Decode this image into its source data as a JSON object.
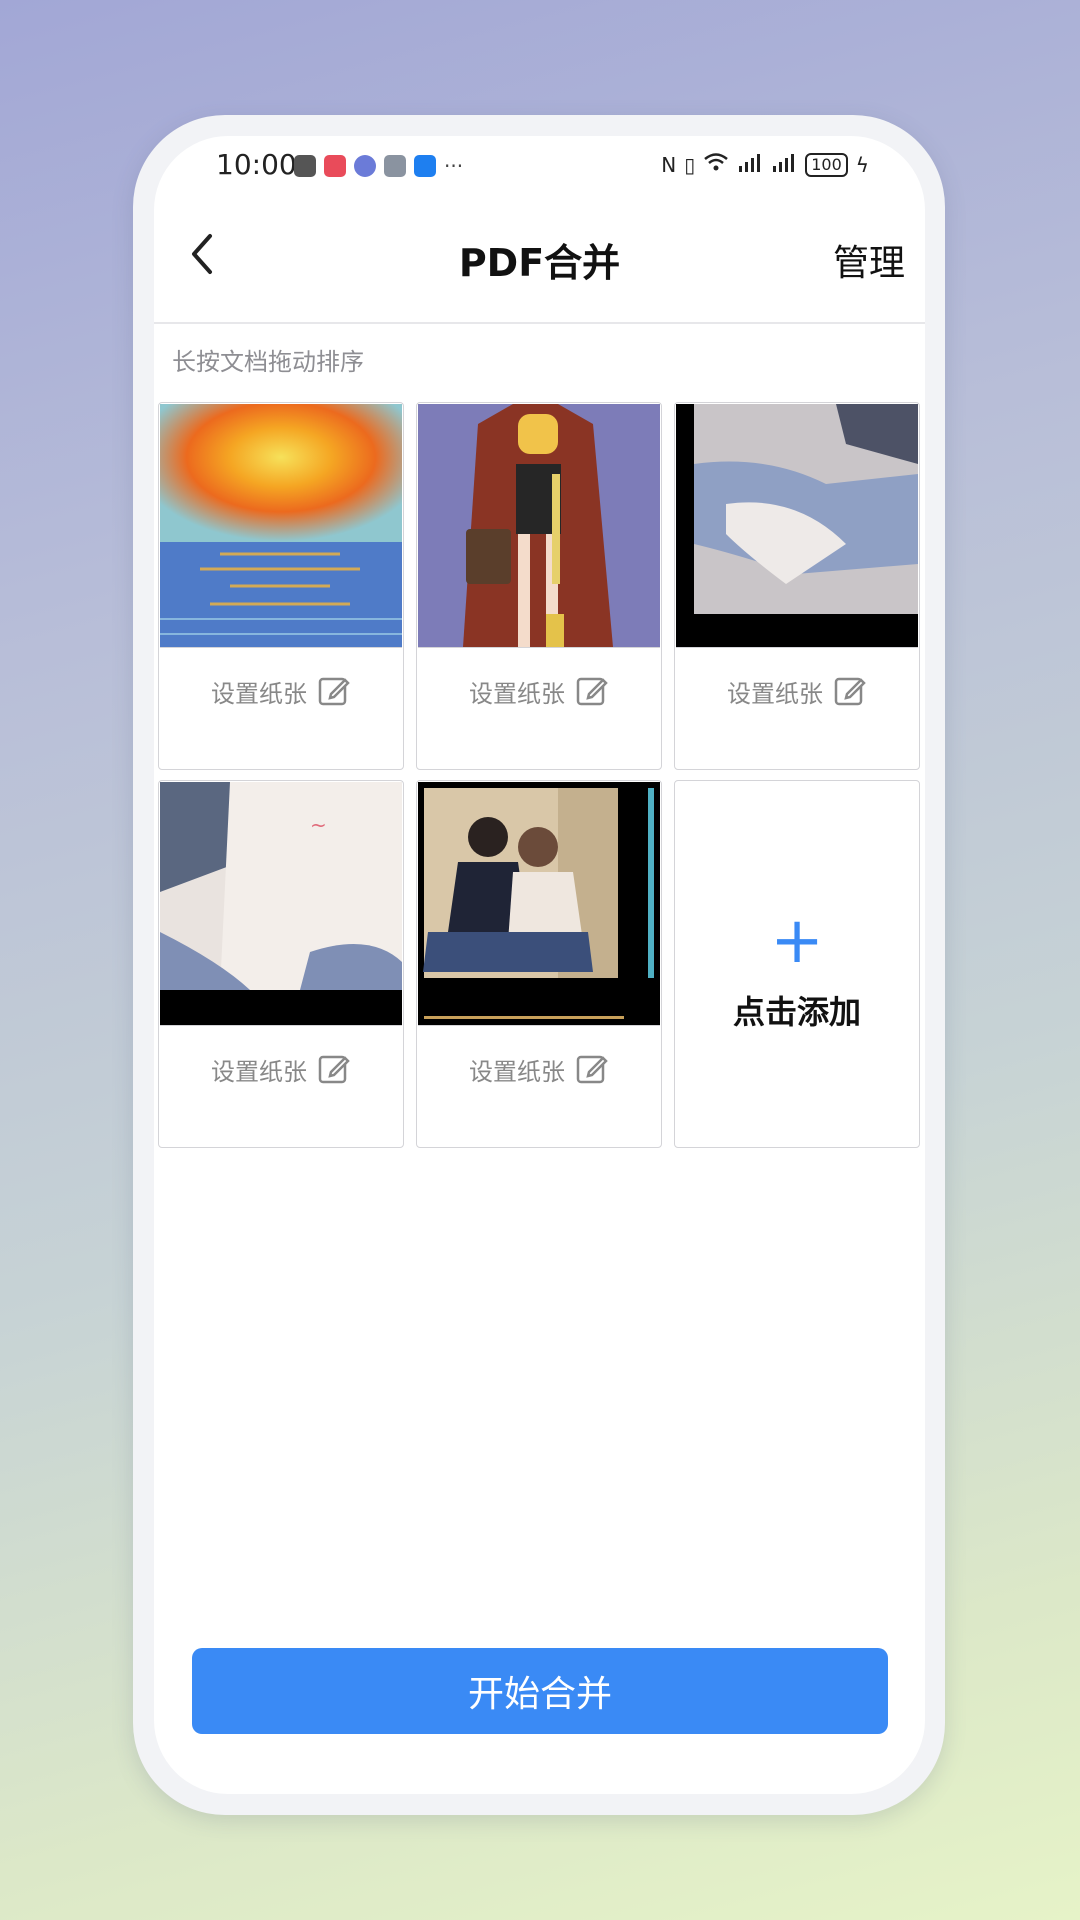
{
  "status_bar": {
    "time": "10:00",
    "battery": "100"
  },
  "header": {
    "title": "PDF合并",
    "manage_label": "管理"
  },
  "hint": "长按文档拖动排序",
  "documents": [
    {
      "setting_label": "设置纸张",
      "image": "sunset-painting"
    },
    {
      "setting_label": "设置纸张",
      "image": "cartoon-figure"
    },
    {
      "setting_label": "设置纸张",
      "image": "photo-legs"
    },
    {
      "setting_label": "设置纸张",
      "image": "photo-sweater"
    },
    {
      "setting_label": "设置纸张",
      "image": "photo-couple"
    }
  ],
  "add_card": {
    "label": "点击添加"
  },
  "merge_button": "开始合并",
  "colors": {
    "accent": "#3a8af5",
    "hint_text": "#8e8e93",
    "border": "#d4d4d8"
  }
}
